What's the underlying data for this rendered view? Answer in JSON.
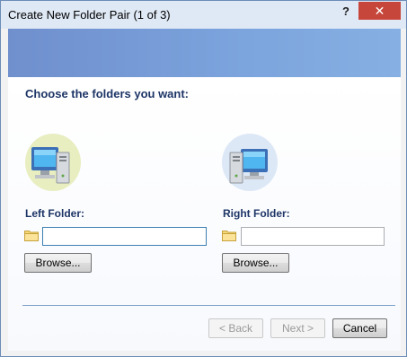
{
  "window": {
    "title": "Create New Folder Pair (1 of 3)",
    "help_label": "?",
    "close_label": "✕"
  },
  "content": {
    "heading": "Choose the folders you want:"
  },
  "left": {
    "label": "Left Folder:",
    "value": "",
    "browse_label": "Browse...",
    "icon": "computer-icon",
    "icon_bg": "#e8eec0"
  },
  "right": {
    "label": "Right Folder:",
    "value": "",
    "browse_label": "Browse...",
    "icon": "computer-icon",
    "icon_bg": "#dde8f7"
  },
  "footer": {
    "back_label": "< Back",
    "next_label": "Next >",
    "cancel_label": "Cancel",
    "back_enabled": false,
    "next_enabled": false
  },
  "colors": {
    "heading": "#1d3566",
    "close": "#c7463b",
    "banner": "#7ca4dd"
  }
}
